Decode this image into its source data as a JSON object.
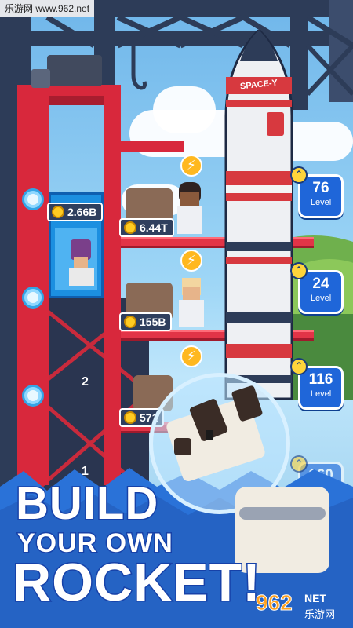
{
  "watermark": {
    "top_text": "乐游网 www.962.net",
    "logo_text": "962",
    "logo_sub": "乐游网",
    "logo_net": "NET"
  },
  "rocket": {
    "label": "SPACE-Y"
  },
  "tower": {
    "floor_numbers": [
      "2",
      "1"
    ]
  },
  "money": {
    "elevator": "2.66B",
    "floor_top": "6.44T",
    "floor_mid": "155B",
    "floor_bottom": "571"
  },
  "levels": [
    {
      "value": "76",
      "label": "Level"
    },
    {
      "value": "24",
      "label": "Level"
    },
    {
      "value": "116",
      "label": "Level"
    },
    {
      "value": "160",
      "label": ""
    }
  ],
  "title": {
    "line1": "BUILD",
    "line2": "YOUR OWN",
    "line3": "ROCKET!"
  },
  "colors": {
    "tower_red": "#d8283c",
    "badge_blue": "#1f66d9",
    "title_stroke": "#1641a8",
    "sky": "#7ec8f2"
  },
  "icons": {
    "upgrade": "upgrade-arrow-icon",
    "coin": "coin-icon",
    "boost": "lightning-bolt-icon"
  }
}
